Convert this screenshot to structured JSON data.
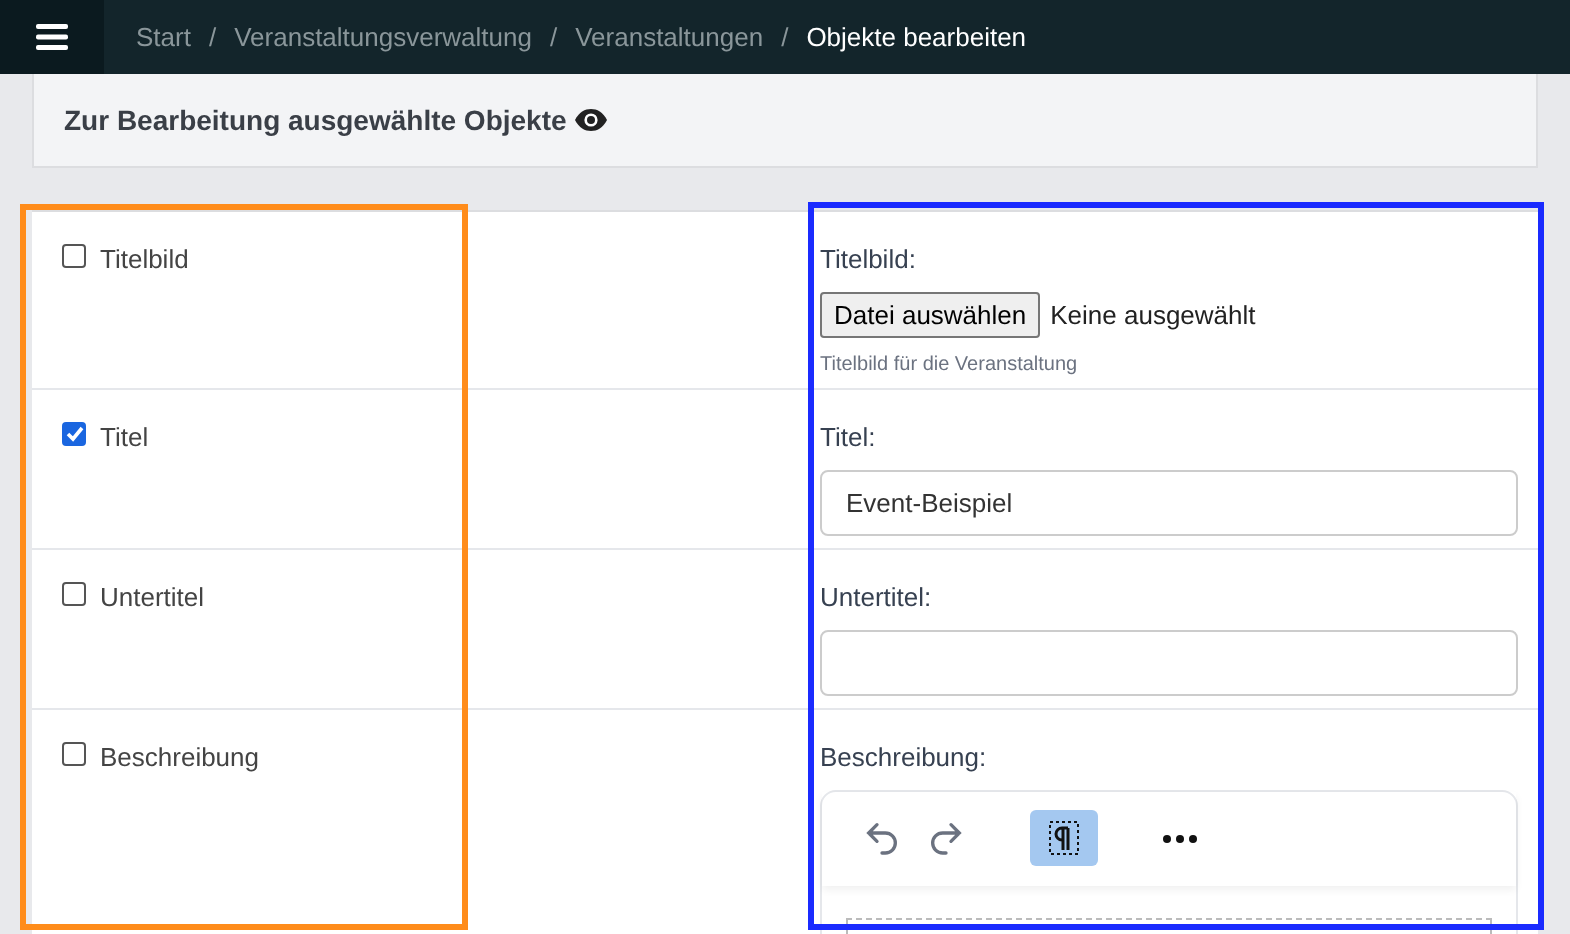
{
  "breadcrumb": [
    {
      "label": "Start",
      "current": false
    },
    {
      "label": "Veranstaltungsverwaltung",
      "current": false
    },
    {
      "label": "Veranstaltungen",
      "current": false
    },
    {
      "label": "Objekte bearbeiten",
      "current": true
    }
  ],
  "separator": "/",
  "header": {
    "title": "Zur Bearbeitung ausgewählte Objekte"
  },
  "rows": [
    {
      "label": "Titelbild",
      "checked": false,
      "field": {
        "kind": "file",
        "label": "Titelbild:",
        "button": "Datei auswählen",
        "status": "Keine ausgewählt",
        "help": "Titelbild für die Veranstaltung"
      }
    },
    {
      "label": "Titel",
      "checked": true,
      "field": {
        "kind": "text",
        "label": "Titel:",
        "value": "Event-Beispiel"
      }
    },
    {
      "label": "Untertitel",
      "checked": false,
      "field": {
        "kind": "text",
        "label": "Untertitel:"
      }
    },
    {
      "label": "Beschreibung",
      "checked": false,
      "field": {
        "kind": "editor",
        "label": "Beschreibung:",
        "paragraph_active": true
      }
    }
  ],
  "annotations": [
    {
      "color": "#ff8c1a"
    },
    {
      "color": "#1a2bff"
    }
  ]
}
